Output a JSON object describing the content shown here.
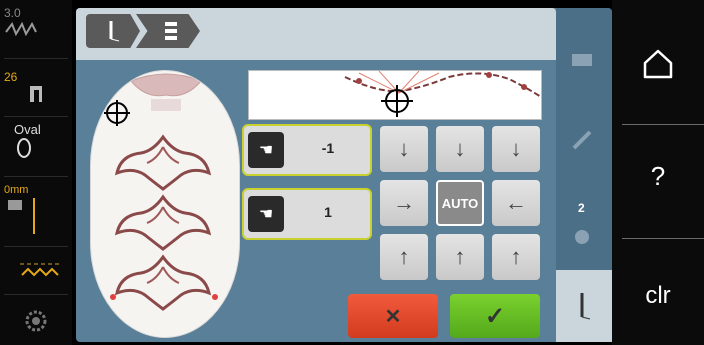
{
  "left_bar": {
    "stitch_value": "3.0",
    "presser_foot_number": "26",
    "hoop_label": "Oval",
    "needle_position": "0mm"
  },
  "breadcrumb": {
    "item1_icon": "needle-icon",
    "item2_icon": "embroidery-hoop-icon"
  },
  "side": {
    "hoop_count": "2"
  },
  "values": {
    "field1": "-1",
    "field2": "1"
  },
  "arrows": {
    "auto_label": "AUTO"
  },
  "actions": {
    "cancel_symbol": "✕",
    "confirm_symbol": "✓"
  },
  "right_nav": {
    "help_label": "?",
    "clear_label": "clr"
  },
  "colors": {
    "accent_yellow": "#c9d12e",
    "panel_blue": "#5a7f99",
    "cancel_red": "#d23b1e",
    "confirm_green": "#53a91b",
    "status_amber": "#e6a817"
  }
}
